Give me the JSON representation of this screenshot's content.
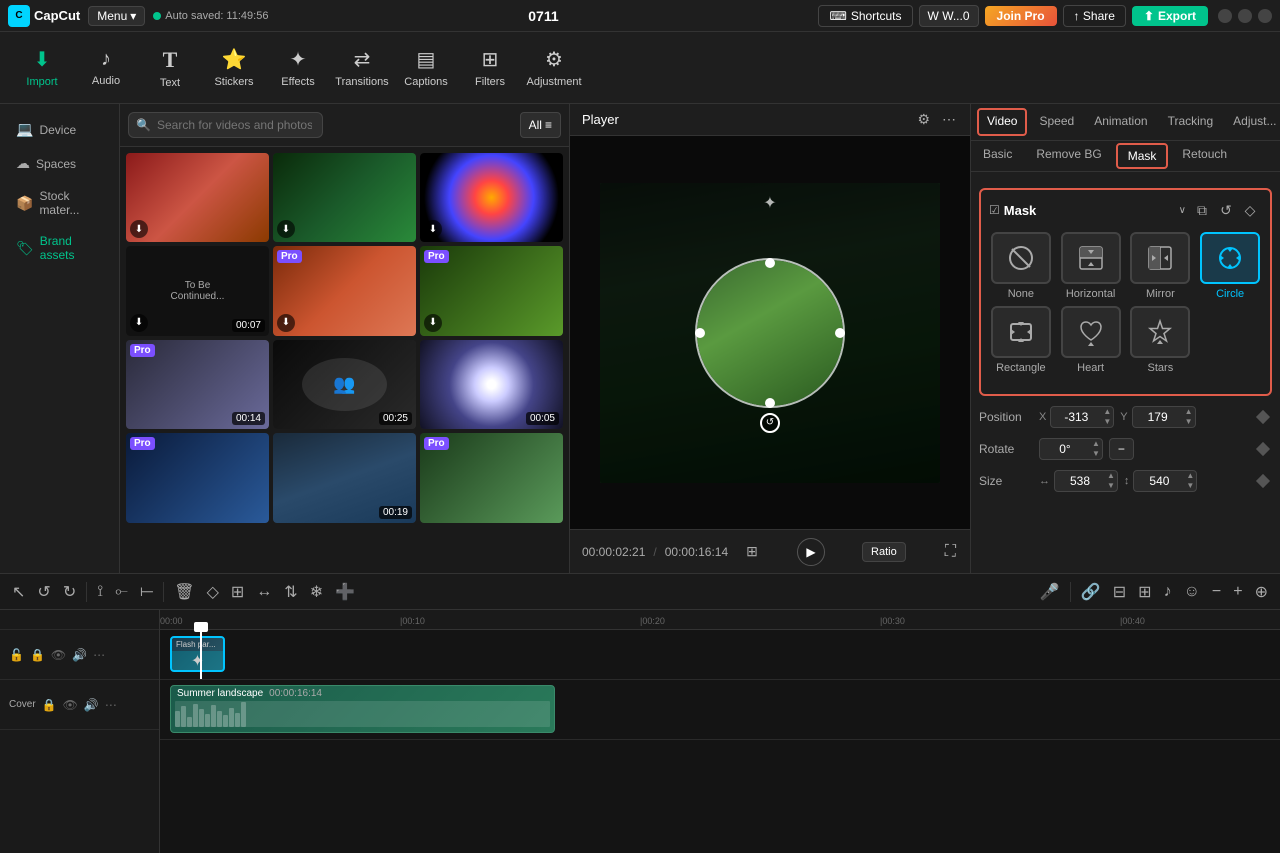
{
  "app": {
    "name": "CapCut",
    "menu_label": "Menu",
    "autosave_text": "Auto saved: 11:49:56",
    "project_title": "0711",
    "shortcuts_label": "Shortcuts",
    "w_label": "W...0",
    "joinpro_label": "Join Pro",
    "share_label": "Share",
    "export_label": "Export"
  },
  "toolbar": {
    "items": [
      {
        "id": "import",
        "label": "Import",
        "icon": "⬇",
        "active": true
      },
      {
        "id": "audio",
        "label": "Audio",
        "icon": "🎵",
        "active": false
      },
      {
        "id": "text",
        "label": "Text",
        "icon": "T",
        "active": false
      },
      {
        "id": "stickers",
        "label": "Stickers",
        "icon": "😊",
        "active": false
      },
      {
        "id": "effects",
        "label": "Effects",
        "icon": "✨",
        "active": false
      },
      {
        "id": "transitions",
        "label": "Transitions",
        "icon": "⇄",
        "active": false
      },
      {
        "id": "captions",
        "label": "Captions",
        "icon": "💬",
        "active": false
      },
      {
        "id": "filters",
        "label": "Filters",
        "icon": "🎨",
        "active": false
      },
      {
        "id": "adjustment",
        "label": "Adjustment",
        "icon": "⚙",
        "active": false
      }
    ]
  },
  "left_panel": {
    "nav_items": [
      {
        "id": "device",
        "label": "Device",
        "icon": "💻"
      },
      {
        "id": "spaces",
        "label": "Spaces",
        "icon": "☁"
      },
      {
        "id": "stock",
        "label": "Stock mater...",
        "icon": "📦"
      },
      {
        "id": "brand",
        "label": "Brand assets",
        "icon": "🏷"
      }
    ],
    "search_placeholder": "Search for videos and photos",
    "all_btn_label": "All",
    "media_items": [
      {
        "id": 1,
        "thumb_class": "thumb-food",
        "duration": "",
        "has_download": true
      },
      {
        "id": 2,
        "thumb_class": "thumb-nature",
        "duration": "",
        "has_download": true
      },
      {
        "id": 3,
        "thumb_class": "thumb-bokeh",
        "duration": "",
        "has_download": true
      },
      {
        "id": 4,
        "thumb_class": "thumb-text",
        "duration": "00:07",
        "has_pro": false
      },
      {
        "id": 5,
        "thumb_class": "thumb-pizza",
        "duration": "",
        "has_pro": true
      },
      {
        "id": 6,
        "thumb_class": "thumb-field",
        "duration": "",
        "has_pro": true
      },
      {
        "id": 7,
        "thumb_class": "thumb-abstract",
        "duration": "00:14",
        "has_pro": true
      },
      {
        "id": 8,
        "thumb_class": "thumb-silhouette",
        "duration": "00:25",
        "has_pro": false
      },
      {
        "id": 9,
        "thumb_class": "thumb-particles",
        "duration": "00:05",
        "has_pro": false
      },
      {
        "id": 10,
        "thumb_class": "thumb-blue",
        "duration": "",
        "has_pro": true
      },
      {
        "id": 11,
        "thumb_class": "thumb-portrait",
        "duration": "00:19",
        "has_pro": false
      },
      {
        "id": 12,
        "thumb_class": "thumb-green",
        "duration": "",
        "has_pro": true
      }
    ]
  },
  "player": {
    "title": "Player",
    "time_current": "00:00:02:21",
    "time_total": "00:00:16:14",
    "ratio_label": "Ratio"
  },
  "right_panel": {
    "tabs": [
      {
        "id": "video",
        "label": "Video",
        "active": true,
        "highlighted": false
      },
      {
        "id": "speed",
        "label": "Speed",
        "active": false,
        "highlighted": false
      },
      {
        "id": "animation",
        "label": "Animation",
        "active": false,
        "highlighted": false
      },
      {
        "id": "tracking",
        "label": "Tracking",
        "active": false,
        "highlighted": false
      },
      {
        "id": "adjustment",
        "label": "Adjust...",
        "active": false,
        "highlighted": false
      }
    ],
    "sub_tabs": [
      {
        "id": "basic",
        "label": "Basic",
        "active": false
      },
      {
        "id": "removebg",
        "label": "Remove BG",
        "active": false
      },
      {
        "id": "mask",
        "label": "Mask",
        "active": true,
        "highlighted": true
      },
      {
        "id": "retouch",
        "label": "Retouch",
        "active": false
      }
    ],
    "mask": {
      "title": "Mask",
      "shapes": [
        {
          "id": "none",
          "label": "None",
          "icon": "⊘",
          "active": false
        },
        {
          "id": "horizontal",
          "label": "Horizontal",
          "icon": "▭",
          "active": false
        },
        {
          "id": "mirror",
          "label": "Mirror",
          "icon": "⊟",
          "active": false
        },
        {
          "id": "circle",
          "label": "Circle",
          "icon": "◯",
          "active": true
        },
        {
          "id": "rectangle",
          "label": "Rectangle",
          "icon": "▢",
          "active": false
        },
        {
          "id": "heart",
          "label": "Heart",
          "icon": "♡",
          "active": false
        },
        {
          "id": "stars",
          "label": "Stars",
          "icon": "☆",
          "active": false
        }
      ],
      "position": {
        "label": "Position",
        "x_label": "X",
        "x_value": "-313",
        "y_label": "Y",
        "y_value": "179"
      },
      "rotate": {
        "label": "Rotate",
        "value": "0°"
      },
      "size": {
        "label": "Size",
        "width_value": "538",
        "height_value": "540"
      }
    }
  },
  "timeline": {
    "time_markers": [
      "00:00",
      "|00:10",
      "|00:20",
      "|00:30",
      "|00:40"
    ],
    "tracks": [
      {
        "id": "flash",
        "label": "",
        "clip_label": "Flash par...",
        "clip_duration": ""
      },
      {
        "id": "main",
        "label": "Cover",
        "clip_label": "Summer landscape",
        "clip_duration": "00:00:16:14"
      }
    ]
  }
}
